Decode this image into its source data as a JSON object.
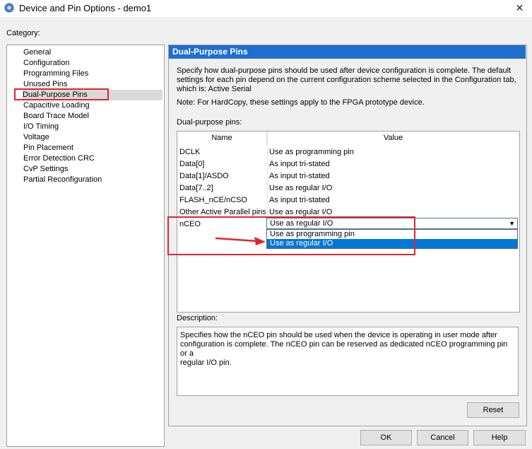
{
  "window": {
    "title": "Device and Pin Options - demo1",
    "close_glyph": "✕"
  },
  "category": {
    "label": "Category:",
    "items": [
      {
        "label": "General"
      },
      {
        "label": "Configuration"
      },
      {
        "label": "Programming Files"
      },
      {
        "label": "Unused Pins"
      },
      {
        "label": "Dual-Purpose Pins",
        "selected": true
      },
      {
        "label": "Capacitive Loading"
      },
      {
        "label": "Board Trace Model"
      },
      {
        "label": "I/O Timing"
      },
      {
        "label": "Voltage"
      },
      {
        "label": "Pin Placement"
      },
      {
        "label": "Error Detection CRC"
      },
      {
        "label": "CvP Settings"
      },
      {
        "label": "Partial Reconfiguration"
      }
    ]
  },
  "panel": {
    "header": "Dual-Purpose Pins",
    "intro_line1": "Specify how dual-purpose pins should be used after device configuration is complete. The default",
    "intro_line2": "settings for each pin depend on the current configuration scheme selected in the Configuration tab,",
    "intro_line3": "which is:  Active Serial",
    "note": "Note: For HardCopy, these settings apply to the FPGA prototype device.",
    "table_label": "Dual-purpose pins:"
  },
  "pins_table": {
    "headers": {
      "name": "Name",
      "value": "Value"
    },
    "rows": [
      {
        "name": "DCLK",
        "value": "Use as programming pin"
      },
      {
        "name": "Data[0]",
        "value": "As input tri-stated"
      },
      {
        "name": "Data[1]/ASDO",
        "value": "As input tri-stated"
      },
      {
        "name": "Data[7..2]",
        "value": "Use as regular I/O"
      },
      {
        "name": "FLASH_nCE/nCSO",
        "value": "As input tri-stated"
      },
      {
        "name": "Other Active Parallel pins",
        "value": "Use as regular I/O"
      },
      {
        "name": "nCEO",
        "value": ""
      }
    ]
  },
  "dropdown": {
    "selected": "Use as regular I/O",
    "options": [
      {
        "label": "Use as programming pin"
      },
      {
        "label": "Use as regular I/O",
        "highlighted": true
      }
    ]
  },
  "description": {
    "label": "Description:",
    "line1": "Specifies how the nCEO pin should be used when the device is operating in user mode after",
    "line2": "configuration is complete. The nCEO pin can be reserved as dedicated nCEO programming pin or a",
    "line3": "regular I/O pin."
  },
  "buttons": {
    "reset": "Reset",
    "ok": "OK",
    "cancel": "Cancel",
    "help": "Help"
  },
  "colors": {
    "header_blue": "#1e6fcf",
    "annotation_red": "#e0262c",
    "highlight_blue": "#0078d7"
  }
}
